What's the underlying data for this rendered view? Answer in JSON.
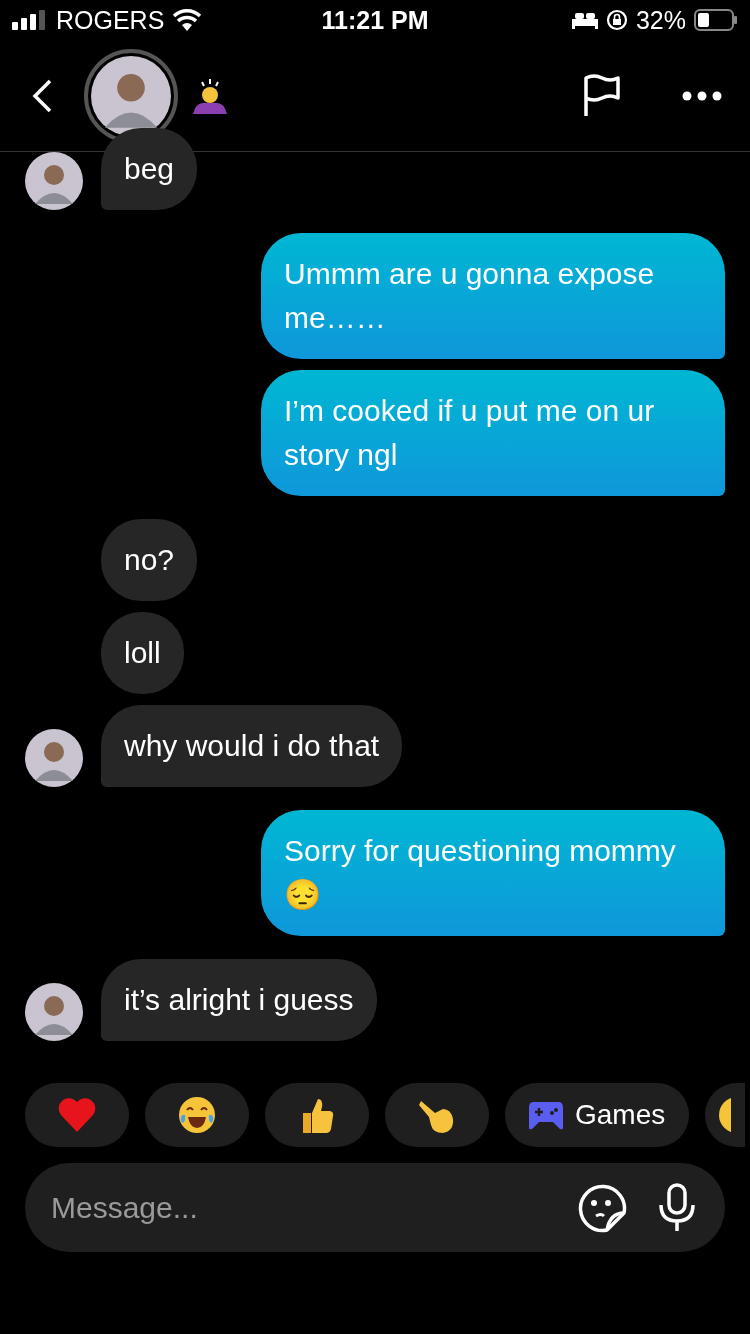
{
  "status_bar": {
    "carrier": "ROGERS",
    "time": "11:21 PM",
    "battery": "32%"
  },
  "messages": [
    {
      "kind": "received",
      "text": "beg",
      "avatar": true
    },
    {
      "kind": "sent",
      "text": "Ummm are u gonna expose me……"
    },
    {
      "kind": "sent",
      "text": "I’m cooked if u put me on ur story ngl"
    },
    {
      "kind": "received",
      "text": "no?",
      "avatar": false
    },
    {
      "kind": "received",
      "text": "loll",
      "avatar": false
    },
    {
      "kind": "received",
      "text": "why would i do that",
      "avatar": true
    },
    {
      "kind": "sent",
      "text": "Sorry for questioning mommy 😔"
    },
    {
      "kind": "received",
      "text": "it’s alright i guess",
      "avatar": true
    }
  ],
  "quick_reactions": [
    {
      "kind": "heart"
    },
    {
      "kind": "laughing"
    },
    {
      "kind": "thumbsup"
    },
    {
      "kind": "pointing"
    },
    {
      "kind": "games",
      "label": "Games"
    },
    {
      "kind": "cut"
    }
  ],
  "composer": {
    "placeholder": "Message..."
  }
}
